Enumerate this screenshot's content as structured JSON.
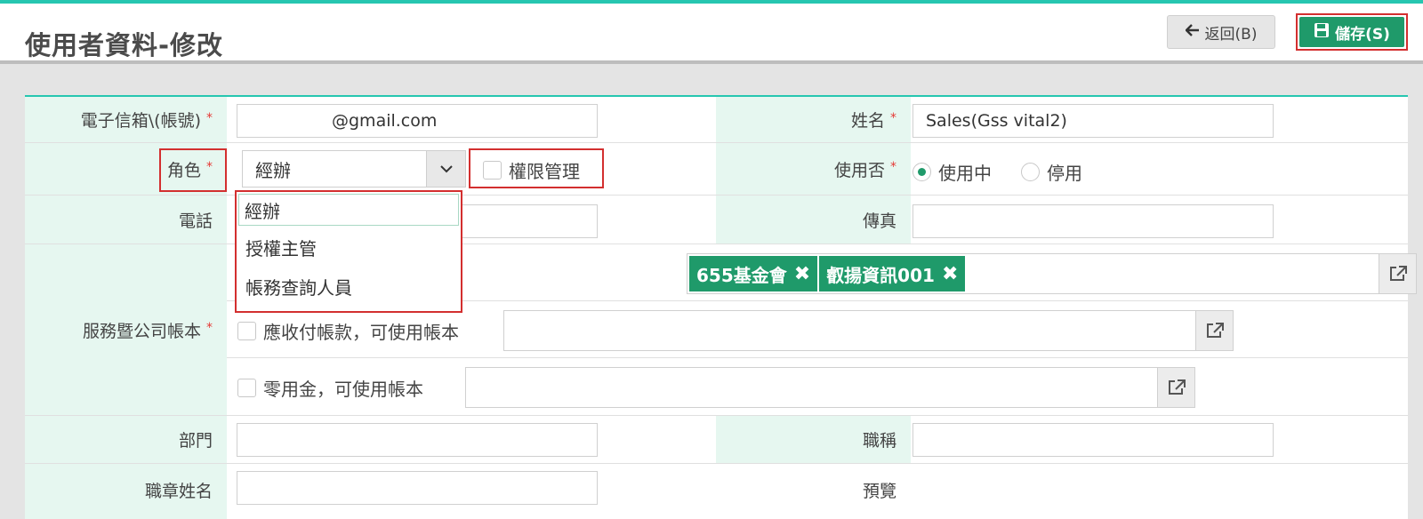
{
  "header": {
    "title": "使用者資料-修改",
    "back_label": "返回(B)",
    "save_label": "儲存(S)"
  },
  "form": {
    "email": {
      "label": "電子信箱\\(帳號)",
      "required": "*",
      "value": "@gmail.com"
    },
    "name": {
      "label": "姓名",
      "required": "*",
      "value": "Sales(Gss vital2)"
    },
    "role": {
      "label": "角色",
      "required": "*",
      "value": "經辦",
      "options": [
        "經辦",
        "授權主管",
        "帳務查詢人員"
      ]
    },
    "permission_admin": {
      "label": "權限管理",
      "checked": false
    },
    "active": {
      "label": "使用否",
      "required": "*",
      "options": [
        "使用中",
        "停用"
      ],
      "selected": "使用中"
    },
    "phone": {
      "label": "電話",
      "value": ""
    },
    "fax": {
      "label": "傳真",
      "value": ""
    },
    "service_books": {
      "label": "服務暨公司帳本",
      "required": "*",
      "tags": [
        "655基金會",
        "叡揚資訊001"
      ],
      "ar_ap_label": "應收付帳款，可使用帳本",
      "petty_cash_label": "零用金，可使用帳本"
    },
    "department": {
      "label": "部門",
      "value": ""
    },
    "job_title": {
      "label": "職稱",
      "value": ""
    },
    "stamp_name": {
      "label": "職章姓名",
      "value": ""
    },
    "preview": {
      "label": "預覽"
    }
  },
  "colors": {
    "accent": "#26c6b0",
    "primary": "#1f9a6a",
    "label_bg": "#e6f7f0",
    "highlight": "#d32f2f"
  }
}
